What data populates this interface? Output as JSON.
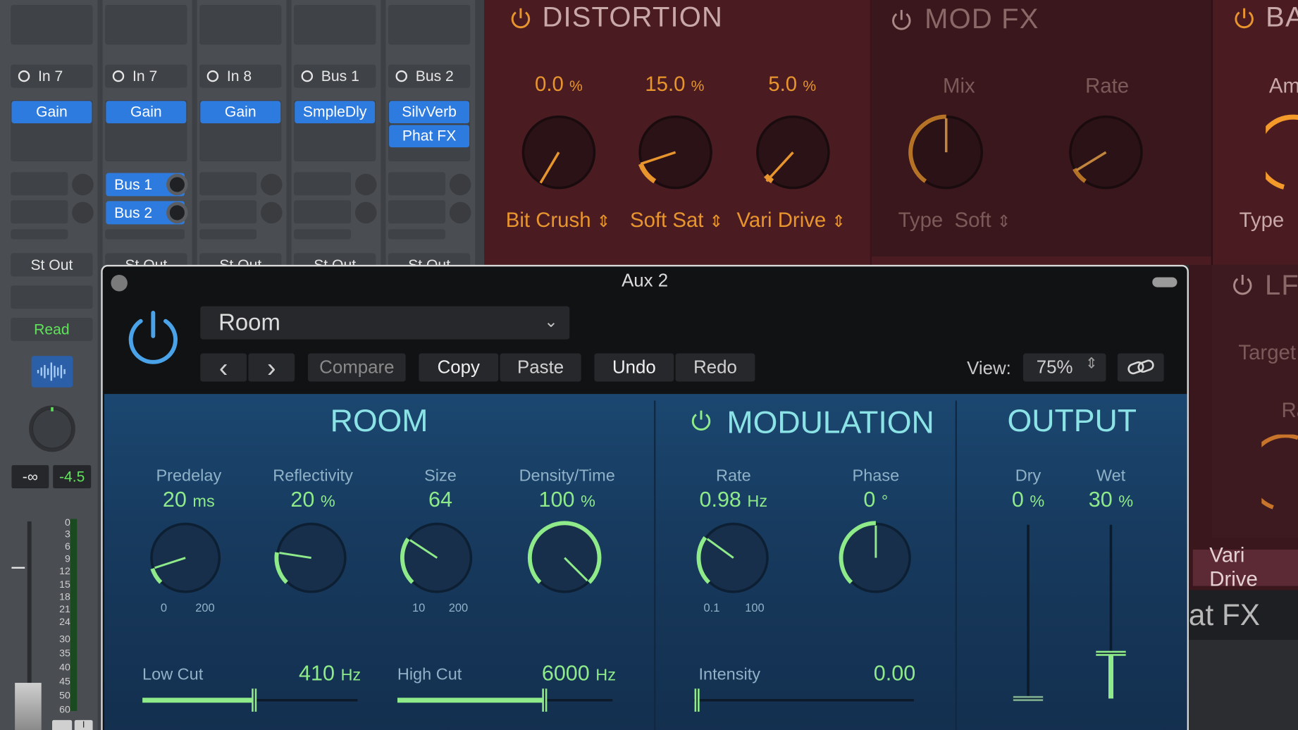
{
  "mixer": {
    "channels": [
      {
        "input": "In 7",
        "plugins": [
          "Gain"
        ],
        "sends": [],
        "output": "St Out"
      },
      {
        "input": "In 7",
        "plugins": [
          "Gain"
        ],
        "sends": [
          "Bus 1",
          "Bus 2"
        ],
        "output": "St Out"
      },
      {
        "input": "In 8",
        "plugins": [
          "Gain"
        ],
        "sends": [],
        "output": "St Out"
      },
      {
        "input": "Bus 1",
        "plugins": [
          "SmpleDly"
        ],
        "sends": [],
        "output": "St Out"
      },
      {
        "input": "Bus 2",
        "plugins": [
          "SilvVerb",
          "Phat FX"
        ],
        "sends": [],
        "output": "St Out"
      }
    ],
    "automation_mode": "Read",
    "meter_peak": "-∞",
    "volume_db": "-4.5",
    "meter_scale": [
      "0",
      "3",
      "6",
      "9",
      "12",
      "15",
      "18",
      "21",
      "24",
      "30",
      "35",
      "40",
      "45",
      "50",
      "60"
    ],
    "solo_mute": [
      "I"
    ]
  },
  "phatfx": {
    "distortion": {
      "title": "DISTORTION",
      "knobs": [
        {
          "value": "0.0",
          "unit": "%",
          "label": "Bit Crush"
        },
        {
          "value": "15.0",
          "unit": "%",
          "label": "Soft Sat"
        },
        {
          "value": "5.0",
          "unit": "%",
          "label": "Vari Drive"
        }
      ]
    },
    "modfx": {
      "title": "MOD FX",
      "mix_label": "Mix",
      "rate_label": "Rate",
      "type_label": "Type",
      "type_value": "Soft"
    },
    "partial_ba": "BA",
    "partial_am": "Am",
    "partial_type": "Type",
    "partial_lf": "LF",
    "partial_target": "Target",
    "partial_ra": "Ra",
    "vari_drive_chip": "Vari Drive",
    "phat_fx_text": "at FX"
  },
  "window": {
    "title": "Aux 2",
    "preset": "Room",
    "nav_prev": "‹",
    "nav_next": "›",
    "compare": "Compare",
    "copy": "Copy",
    "paste": "Paste",
    "undo": "Undo",
    "redo": "Redo",
    "view_label": "View:",
    "view_value": "75%"
  },
  "silververb": {
    "room": {
      "title": "ROOM",
      "predelay": {
        "label": "Predelay",
        "value": "20",
        "unit": "ms",
        "min": "0",
        "max": "200",
        "fraction": 0.1
      },
      "reflectivity": {
        "label": "Reflectivity",
        "value": "20",
        "unit": "%",
        "fraction": 0.2
      },
      "size": {
        "label": "Size",
        "value": "64",
        "min": "10",
        "max": "200",
        "fraction": 0.29
      },
      "density": {
        "label": "Density/Time",
        "value": "100",
        "unit": "%",
        "fraction": 1.0
      },
      "low_cut": {
        "label": "Low Cut",
        "value": "410",
        "unit": "Hz",
        "fraction": 0.52
      },
      "high_cut": {
        "label": "High Cut",
        "value": "6000",
        "unit": "Hz",
        "fraction": 0.69
      }
    },
    "modulation": {
      "title": "MODULATION",
      "rate": {
        "label": "Rate",
        "value": "0.98",
        "unit": "Hz",
        "min": "0.1",
        "max": "100",
        "fraction": 0.3
      },
      "phase": {
        "label": "Phase",
        "value": "0",
        "unit": "°",
        "fraction": 0.5
      },
      "intensity": {
        "label": "Intensity",
        "value": "0.00",
        "fraction": 0.0
      }
    },
    "output": {
      "title": "OUTPUT",
      "dry": {
        "label": "Dry",
        "value": "0",
        "unit": "%",
        "fraction": 0.0
      },
      "wet": {
        "label": "Wet",
        "value": "30",
        "unit": "%",
        "fraction": 0.3
      }
    }
  },
  "colors": {
    "accent_green": "#8fea8a",
    "title_cyan": "#8be3e6",
    "orange": "#e8952e",
    "power_blue": "#4aa3e8",
    "plugin_blue": "#2e7be0"
  }
}
